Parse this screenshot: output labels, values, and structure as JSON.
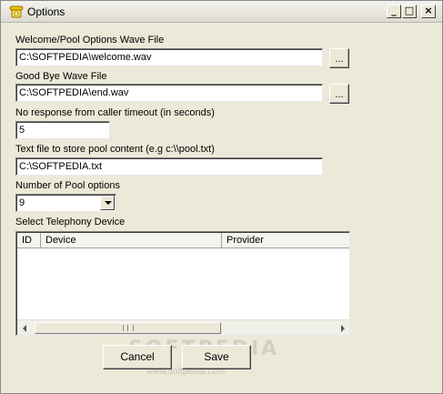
{
  "window": {
    "title": "Options"
  },
  "fields": {
    "welcome_label": "Welcome/Pool Options Wave File",
    "welcome_value": "C:\\SOFTPEDIA\\welcome.wav",
    "goodbye_label": "Good Bye Wave File",
    "goodbye_value": "C:\\SOFTPEDIA\\end.wav",
    "timeout_label": "No response from caller timeout (in seconds)",
    "timeout_value": "5",
    "textfile_label": "Text file to store pool content (e.g c:\\\\pool.txt)",
    "textfile_value": "C:\\SOFTPEDIA.txt",
    "pool_options_label": "Number of Pool options",
    "pool_options_value": "9",
    "device_label": "Select Telephony Device"
  },
  "browse_label": "...",
  "device_table": {
    "columns": [
      "ID",
      "Device",
      "Provider"
    ],
    "rows": []
  },
  "buttons": {
    "cancel": "Cancel",
    "save": "Save"
  },
  "watermark": {
    "text": "SOFTPEDIA",
    "url": "www.softpedia.com"
  }
}
